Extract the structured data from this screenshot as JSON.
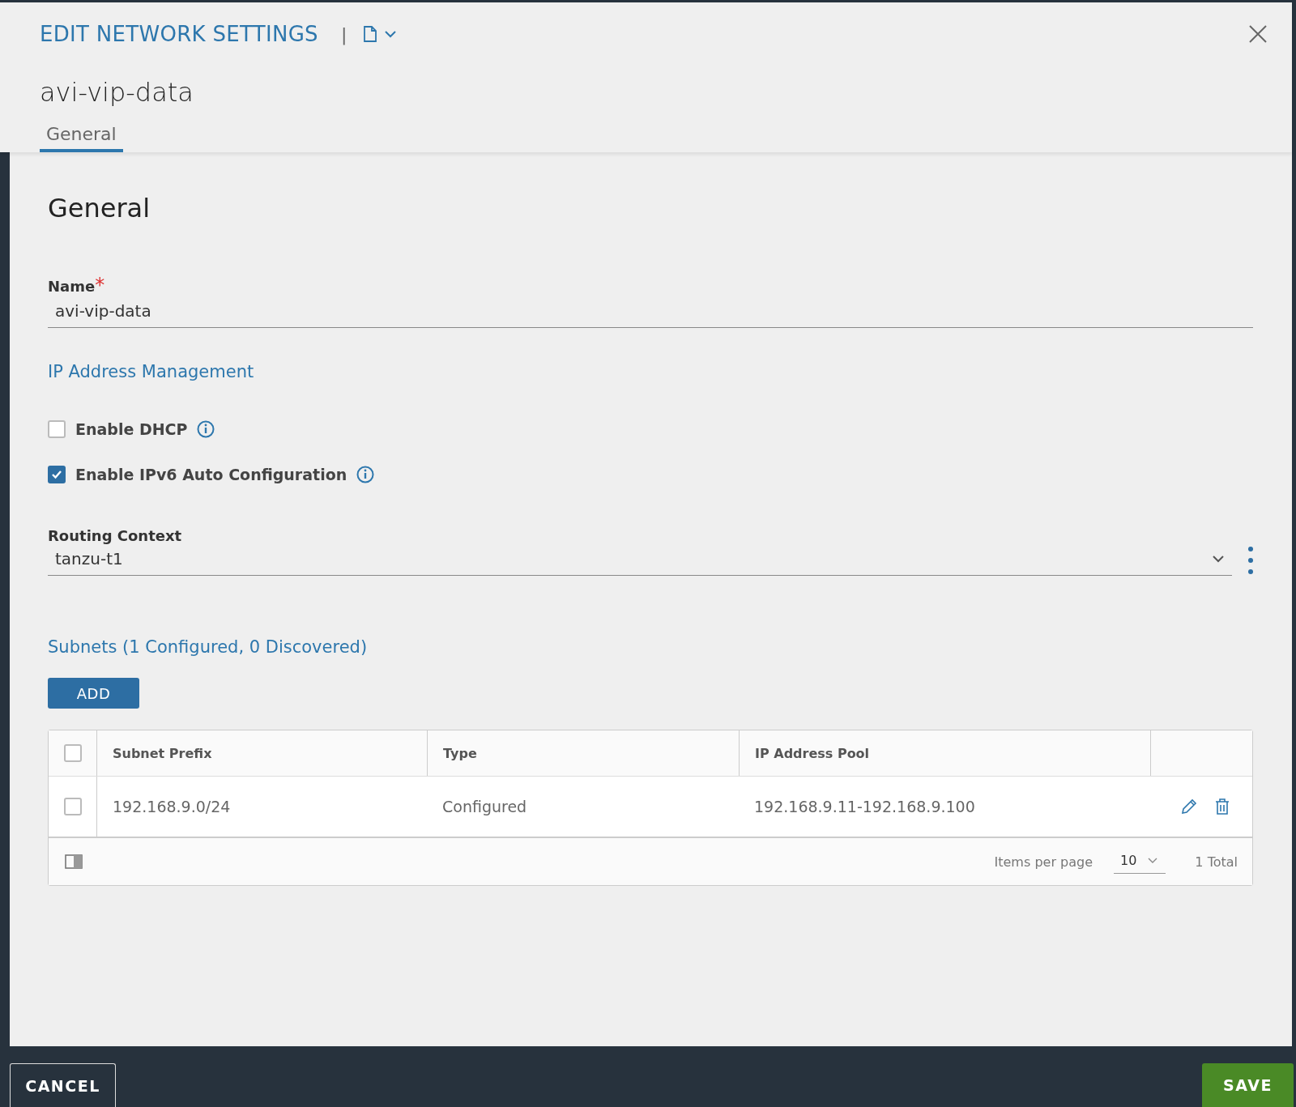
{
  "dialog": {
    "title": "EDIT NETWORK SETTINGS",
    "separator": "|",
    "object_name": "avi-vip-data"
  },
  "tabs": [
    {
      "label": "General",
      "selected": true
    }
  ],
  "section": {
    "heading": "General"
  },
  "name_field": {
    "label": "Name",
    "required_mark": "*",
    "value": "avi-vip-data"
  },
  "ip_management": {
    "heading": "IP Address Management",
    "options": [
      {
        "label": "Enable DHCP",
        "checked": false
      },
      {
        "label": "Enable IPv6 Auto Configuration",
        "checked": true
      }
    ]
  },
  "routing_context": {
    "label": "Routing Context",
    "value": "tanzu-t1"
  },
  "subnets": {
    "heading": "Subnets (1 Configured, 0 Discovered)",
    "add_button": "ADD",
    "all_selected": false,
    "columns": [
      "Subnet Prefix",
      "Type",
      "IP Address Pool"
    ],
    "rows": [
      {
        "selected": false,
        "cells": [
          "192.168.9.0/24",
          "Configured",
          "192.168.9.11-192.168.9.100"
        ]
      }
    ],
    "footer": {
      "items_per_page_label": "Items per page",
      "items_per_page": "10",
      "total": "1 Total"
    }
  },
  "buttons": {
    "cancel": "CANCEL",
    "save": "SAVE"
  }
}
